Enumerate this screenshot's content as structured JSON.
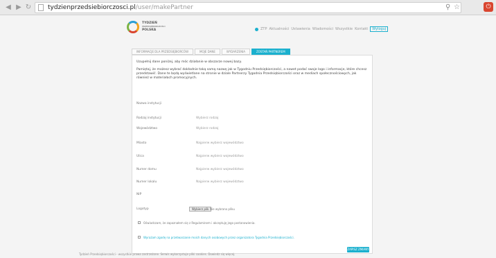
{
  "browser": {
    "url_host": "tydzienprzedsiebiorczosci.pl",
    "url_path": "/user/makePartner"
  },
  "brand": {
    "accent": "#1bb0ce",
    "logo_line1": "TYDZIEŃ",
    "logo_line2": "PRZEDSIĘBIORCZOŚCI",
    "logo_line3": "POLSKA"
  },
  "topnav": {
    "items": [
      "ZTP",
      "Aktualności",
      "Ustawienia",
      "Wiadomości",
      "Wszystkie",
      "Kontakt"
    ],
    "logout_label": "Wyloguj"
  },
  "tabs": [
    {
      "label": "INFORMACJE DLA PRZEDSIĘBIORCÓW",
      "active": false
    },
    {
      "label": "MOJE DANE",
      "active": false
    },
    {
      "label": "WYDARZENIA",
      "active": false
    },
    {
      "label": "ZOSTAŃ PARTNEREM",
      "active": true
    }
  ],
  "form": {
    "intro_1": "Uzupełnij dane poniżej, aby móc działanie w obszarze nowej bazy.",
    "intro_2": "Pamiętaj, że możesz wybrać dokładnie taką samą nazwę jak w Tygodniu Przedsiębiorczości, a nawet podać swoje logo i informacje, które chcesz przedstawić. Dane te będą wyświetlane na stronie w dziale Partnerzy Tygodnia Przedsiębiorczości oraz w mediach społecznościowych, jak również w materiałach promocyjnych.",
    "fields": [
      {
        "label": "Nazwa instytucji",
        "value": ""
      },
      {
        "label": "Rodzaj instytucji",
        "value": "Wybierz rodzaj"
      },
      {
        "label": "Województwo",
        "value": "Wybierz rodzaj"
      },
      {
        "label": "Miasto",
        "value": "Najpierw wybierz województwo"
      },
      {
        "label": "Ulica",
        "value": "Najpierw wybierz województwo"
      },
      {
        "label": "Numer domu",
        "value": "Najpierw wybierz województwo"
      },
      {
        "label": "Numer lokalu",
        "value": "Najpierw wybierz województwo"
      },
      {
        "label": "NIP",
        "value": ""
      }
    ],
    "logo_label": "Logotyp",
    "file_button": "Wybierz plik",
    "file_status": "Nie wybrano pliku",
    "consent_1": "Oświadczam, że zapoznałem się z Regulaminem i akceptuję jego postanowienia.",
    "consent_2": "Wyrażam zgodę na przetwarzanie moich danych osobowych przez organizatora Tygodnia Przedsiębiorczości.",
    "save_label": "ZAPISZ ZMIANY"
  },
  "footer": {
    "text": "Tydzień Przedsiębiorczości - wszystkie prawa zastrzeżone. Serwis wykorzystuje pliki cookies. Dowiedz się więcej."
  }
}
